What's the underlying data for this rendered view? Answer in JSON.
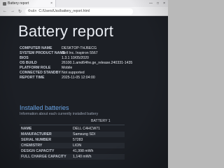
{
  "browser": {
    "tab_label": "Battery report",
    "tab_close": "×",
    "window_controls": [
      "—",
      "□",
      "×"
    ],
    "nav_back": "←",
    "nav_forward": "→",
    "nav_refresh": "↻",
    "address_label": "Файл",
    "address_value": "C:/Users/Uss/battery_report.html"
  },
  "report": {
    "title": "Battery report",
    "system_info": [
      {
        "label": "COMPUTER NAME",
        "value": "DESKTOP-THJ6ECG"
      },
      {
        "label": "SYSTEM PRODUCT NAME",
        "value": "Dell Inc. Inspiron 5567"
      },
      {
        "label": "BIOS",
        "value": "1.3.1 10/05/2020"
      },
      {
        "label": "OS BUILD",
        "value": "26100.1.amd64fre.ge_release.240331-1435"
      },
      {
        "label": "PLATFORM ROLE",
        "value": "Mobile"
      },
      {
        "label": "CONNECTED STANDBY",
        "value": "Not supported"
      },
      {
        "label": "REPORT TIME",
        "value": "2025-11-05  12:04:00"
      }
    ],
    "installed_title": "Installed batteries",
    "installed_subtitle": "Information about each currently installed battery",
    "battery_header": "BATTERY 1",
    "battery_rows": [
      {
        "label": "NAME",
        "value": "DELL C4HCW71"
      },
      {
        "label": "MANUFACTURER",
        "value": "Samsung SDI"
      },
      {
        "label": "SERIAL NUMBER",
        "value": "57283"
      },
      {
        "label": "CHEMISTRY",
        "value": "LION"
      },
      {
        "label": "DESIGN CAPACITY",
        "value": "41,998 mWh"
      },
      {
        "label": "FULL CHARGE CAPACITY",
        "value": "1,140 mWh"
      }
    ]
  }
}
